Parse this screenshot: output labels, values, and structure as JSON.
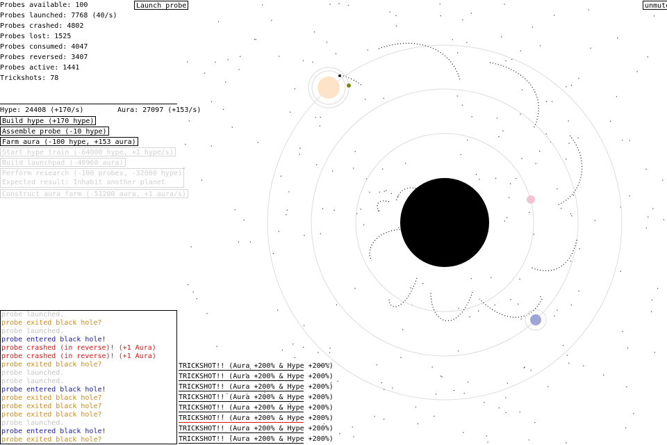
{
  "stats": [
    "Probes available: 100",
    "Probes launched: 7768 (40/s)",
    "Probes crashed: 4802",
    "Probes lost: 1525",
    "Probes consumed: 4047",
    "Probes reversed: 3407",
    "Probes active: 1441",
    "Trickshots: 78"
  ],
  "launch_button": "Launch probe",
  "unmute_button": "unmute",
  "resources": {
    "hype": "Hype: 24408 (+170/s)",
    "aura": "Aura: 27097 (+153/s)"
  },
  "actions": {
    "build_hype": "Build hype (+170 hype)",
    "assemble_probe": "Assemble probe (-10 hype)",
    "farm_aura": "Farm aura (-100 hype, +153 aura)",
    "hype_train": "Start hype train (-64000 hype, +1 hype/s)",
    "launchpad": "Build launchpad (-40960 aura)",
    "research_line1": "Perform research (-100 probes, -32000 hype)",
    "research_line2": "Expected result: Inhabit another planet",
    "aura_farm": "Construct aura farm (-51200 aura, +1 aura/s)"
  },
  "log": [
    {
      "text": "probe launched.",
      "kind": "gray"
    },
    {
      "text": "probe exited black hole?",
      "kind": "orange"
    },
    {
      "text": "probe launched.",
      "kind": "gray"
    },
    {
      "text": "probe entered black hole!",
      "kind": "blue"
    },
    {
      "text": "probe crashed (in reverse)! (+1 Aura)",
      "kind": "red"
    },
    {
      "text": "probe crashed (in reverse)! (+1 Aura)",
      "kind": "red"
    },
    {
      "text": "probe exited black hole?",
      "kind": "orange"
    },
    {
      "text": "probe launched.",
      "kind": "gray"
    },
    {
      "text": "probe launched.",
      "kind": "gray"
    },
    {
      "text": "probe entered black hole!",
      "kind": "blue"
    },
    {
      "text": "probe exited black hole?",
      "kind": "orange"
    },
    {
      "text": "probe exited black hole?",
      "kind": "orange"
    },
    {
      "text": "probe exited black hole?",
      "kind": "orange"
    },
    {
      "text": "probe launched.",
      "kind": "gray"
    },
    {
      "text": "probe entered black hole!",
      "kind": "blue"
    },
    {
      "text": "probe exited black hole?",
      "kind": "orange"
    }
  ],
  "trickshots": [
    "TRICKSHOT!! (Aura +200% & Hype +200%)",
    "TRICKSHOT!! (Aura +200% & Hype +200%)",
    "TRICKSHOT!! (Aura +200% & Hype +200%)",
    "TRICKSHOT!! (Aura +200% & Hype +200%)",
    "TRICKSHOT!! (Aura +200% & Hype +200%)",
    "TRICKSHOT!! (Aura +200% & Hype +200%)",
    "TRICKSHOT!! (Aura +200% & Hype +200%)",
    "TRICKSHOT!! (Aura +200% & Hype +200%)"
  ],
  "colors": {
    "black_hole": "#000000",
    "home_planet": "#fde3c8",
    "pink_planet": "#f4c4d4",
    "blue_planet": "#a0a6d4",
    "moon": "#7a8a10",
    "orbit": "#d8d8d8"
  }
}
